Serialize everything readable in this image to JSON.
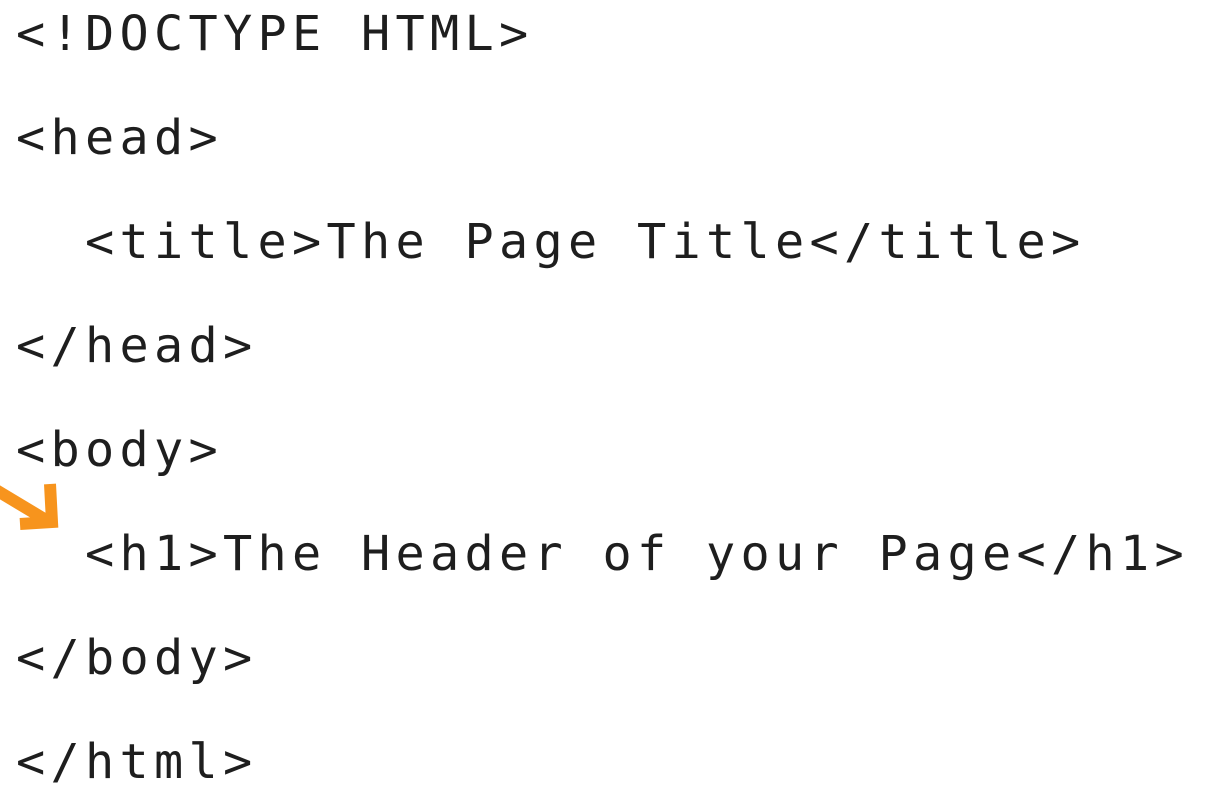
{
  "code": {
    "lines": [
      "<!DOCTYPE HTML>",
      "<head>",
      "  <title>The Page Title</title>",
      "</head>",
      "<body>",
      "  <h1>The Header of your Page</h1>",
      "</body>",
      "</html>"
    ]
  },
  "annotation": {
    "icon": "arrow-down-right-icon",
    "color": "#f7941d"
  }
}
